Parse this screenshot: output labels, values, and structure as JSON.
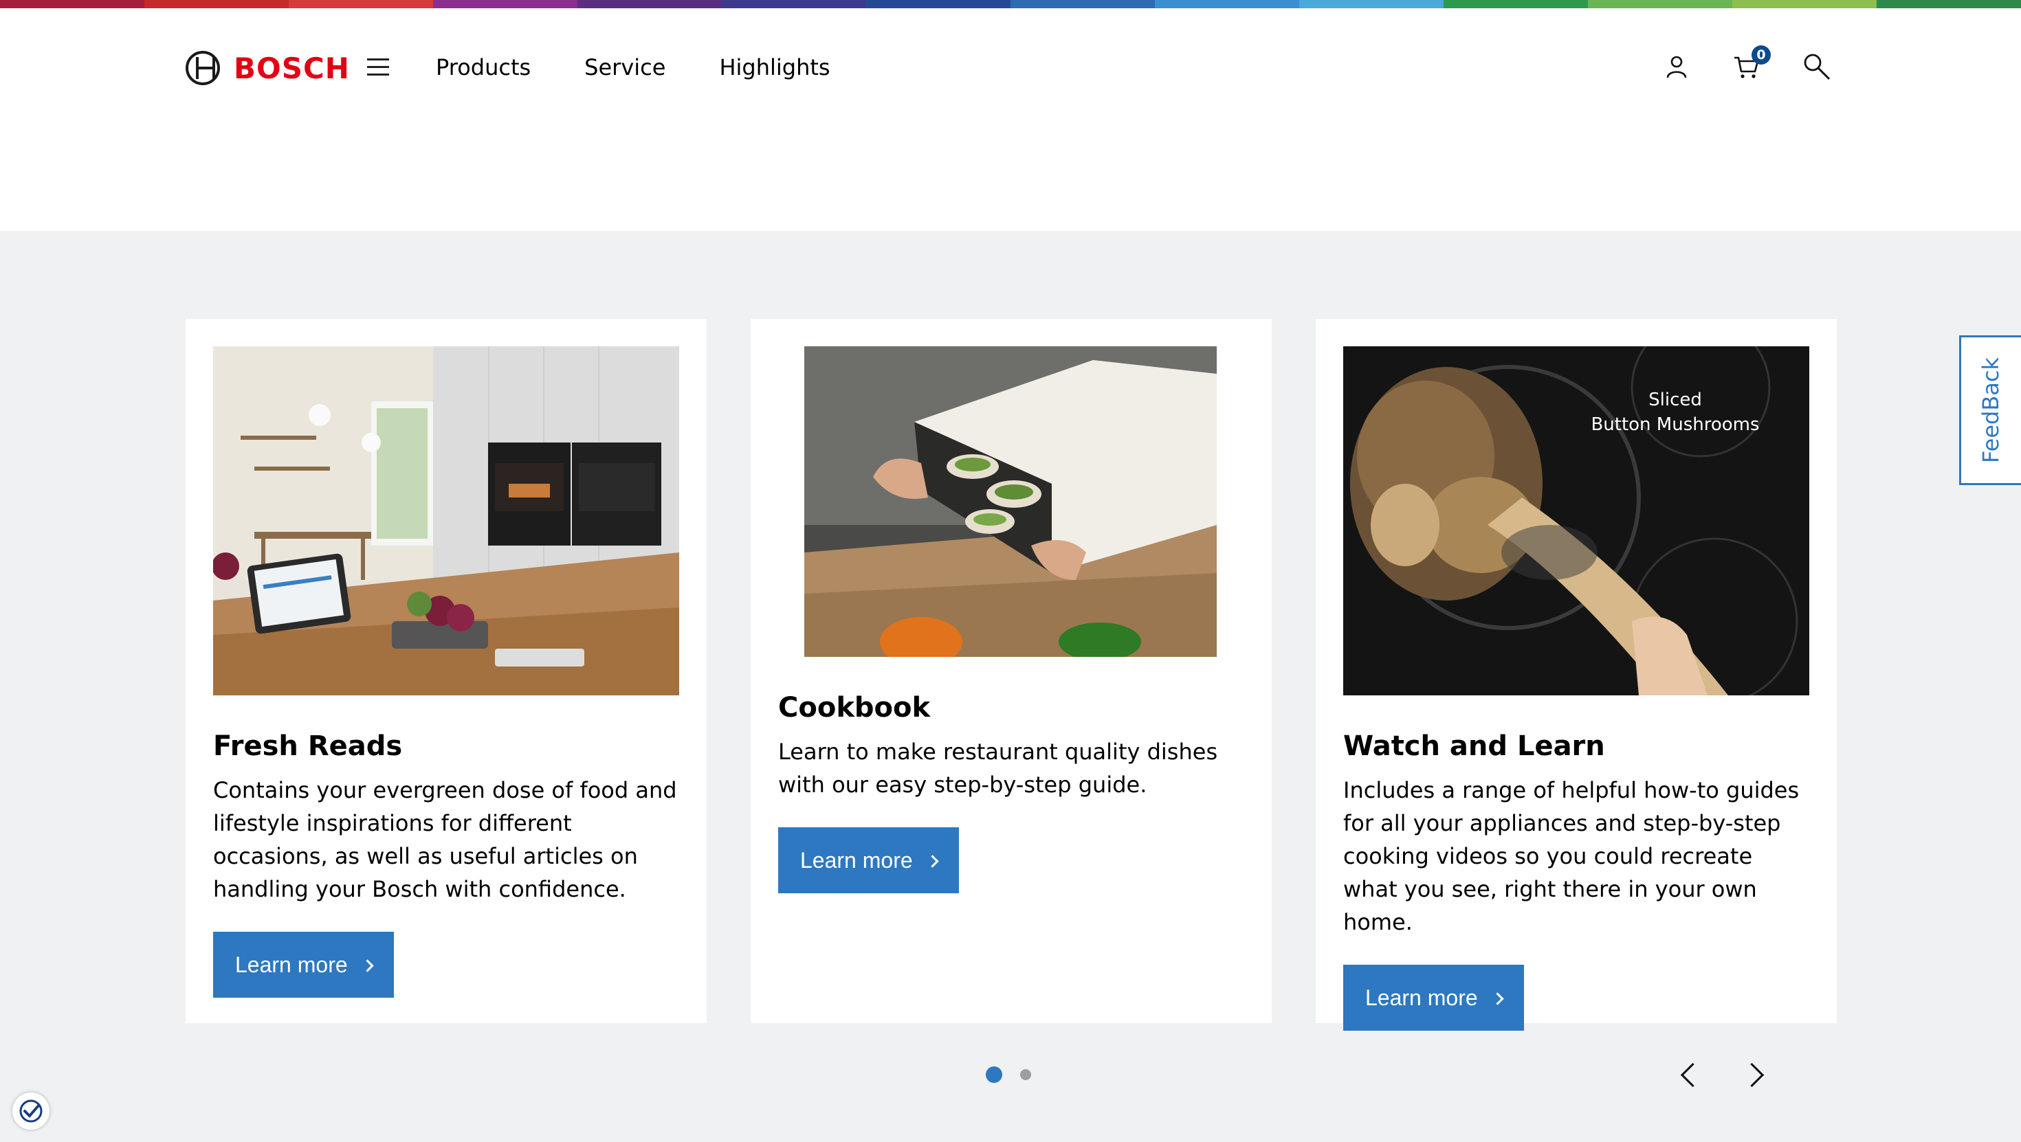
{
  "brand": {
    "name": "BOSCH",
    "color": "#e20015",
    "stripe_colors": [
      "#a71e3c",
      "#c62a2a",
      "#d63a3a",
      "#8b2f8c",
      "#5a2d82",
      "#3c3a8e",
      "#244a95",
      "#2d6cb0",
      "#3b8fd0",
      "#4aa9d9",
      "#2d9a4e",
      "#6bb453",
      "#8cbf4f",
      "#2d8a4a"
    ]
  },
  "nav": {
    "items": [
      "Products",
      "Service",
      "Highlights"
    ]
  },
  "cart": {
    "count": "0"
  },
  "cards": [
    {
      "title": "Fresh Reads",
      "text": "Contains your evergreen dose of food and lifestyle inspirations for different occasions, as well as useful articles on handling your Bosch with confidence.",
      "button": "Learn more"
    },
    {
      "title": "Cookbook",
      "text": "Learn to make restaurant quality dishes with our easy step-by-step guide.",
      "button": "Learn more"
    },
    {
      "title": "Watch and Learn",
      "text": "Includes a range of helpful how-to guides for all your appliances and step-by-step cooking videos so you could recreate what you see, right there in your own home.",
      "button": "Learn more",
      "image_caption_line1": "Sliced",
      "image_caption_line2": "Button Mushrooms"
    }
  ],
  "feedback": {
    "label": "FeedBack"
  },
  "carousel": {
    "pages": 2,
    "current_page": 1
  },
  "colors": {
    "accent": "#2d78c0",
    "background": "#eff1f2"
  }
}
